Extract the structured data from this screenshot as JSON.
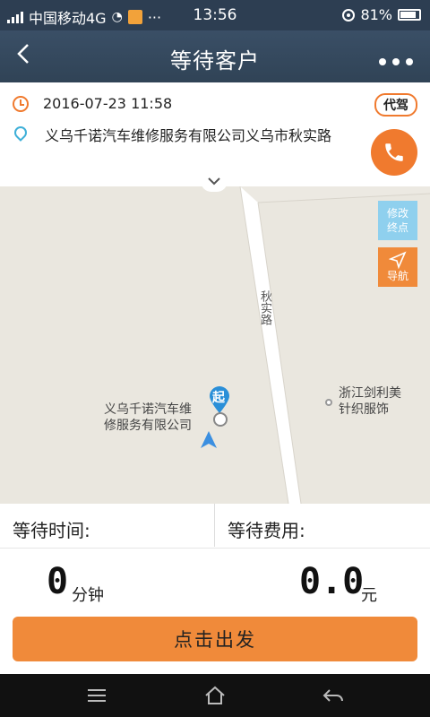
{
  "status_bar": {
    "carrier": "中国移动4G",
    "dots": "···",
    "time": "13:56",
    "battery": "81%"
  },
  "nav": {
    "title": "等待客户",
    "back_icon": "chevron-left-icon",
    "more_icon": "more-dots-icon"
  },
  "order": {
    "datetime": "2016-07-23 11:58",
    "address": "义乌千诺汽车维修服务有限公司义乌市秋实路",
    "badge": "代驾"
  },
  "map": {
    "road_name": "秋实路",
    "poi_origin": "义乌千诺汽车维修服务有限公司",
    "poi_origin_line1": "义乌千诺汽车维",
    "poi_origin_line2": "修服务有限公司",
    "poi_other_line1": "浙江剑利美",
    "poi_other_line2": "针织服饰",
    "start_marker": "起",
    "edit_dest_line1": "修改",
    "edit_dest_line2": "终点",
    "navigate_label": "导航",
    "colors": {
      "edit_dest": "#8fd0ee",
      "navigate": "#f08a3a",
      "marker": "#2a8fd8"
    }
  },
  "waiting": {
    "time_label": "等待时间:",
    "fee_label": "等待费用:",
    "minutes": "0",
    "minutes_unit": "分钟",
    "fee": "0.0",
    "fee_unit": "元"
  },
  "action": {
    "depart_label": "点击出发"
  },
  "system_nav": [
    "menu-icon",
    "home-icon",
    "back-icon"
  ]
}
